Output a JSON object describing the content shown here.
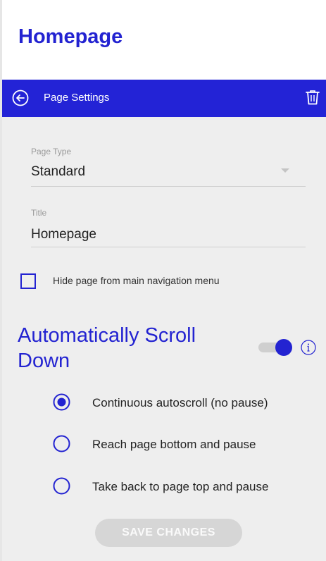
{
  "page": {
    "title": "Homepage"
  },
  "header": {
    "title": "Page Settings",
    "back_icon": "back-arrow-icon",
    "trash_icon": "trash-icon"
  },
  "form": {
    "page_type": {
      "label": "Page Type",
      "value": "Standard"
    },
    "title_field": {
      "label": "Title",
      "value": "Homepage"
    },
    "hide_checkbox": {
      "label": "Hide page from main navigation menu",
      "checked": false
    }
  },
  "autoscroll": {
    "heading": "Automatically Scroll Down",
    "enabled": true,
    "info_icon": "info-icon",
    "options": [
      {
        "label": "Continuous autoscroll (no pause)",
        "selected": true
      },
      {
        "label": "Reach page bottom and pause",
        "selected": false
      },
      {
        "label": "Take back to page top and pause",
        "selected": false
      }
    ]
  },
  "actions": {
    "save_label": "SAVE CHANGES"
  },
  "colors": {
    "accent": "#2323d6",
    "panel_bg": "#eeeeee",
    "disabled_button": "#d6d6d6"
  }
}
